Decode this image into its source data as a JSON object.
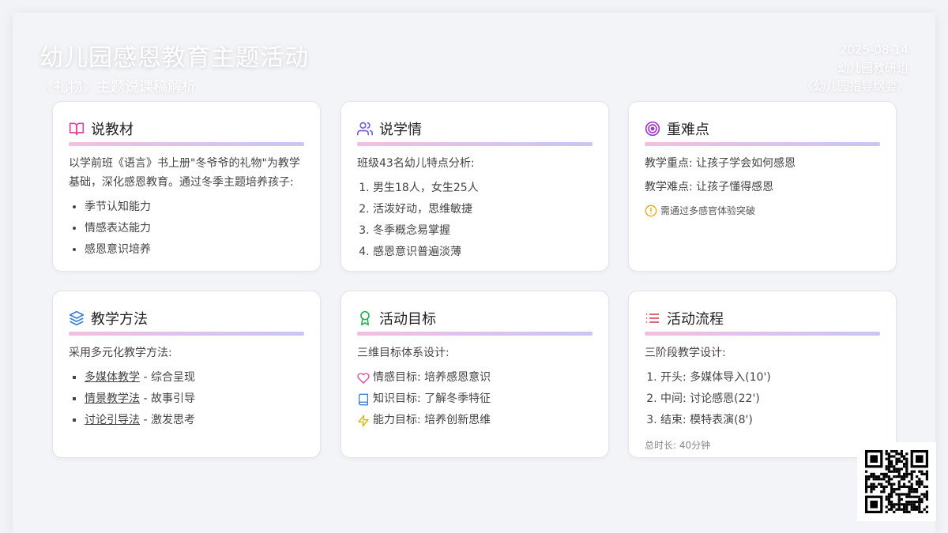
{
  "header": {
    "title": "幼儿园感恩教育主题活动",
    "subtitle": "《礼物》主题说课稿解析",
    "date": "2025-08-14",
    "org": "幼儿园教研组",
    "guide": "《幼儿园指导纲要》"
  },
  "cards": {
    "material": {
      "title": "说教材",
      "icon": "book-open-icon",
      "intro": "以学前班《语言》书上册\"冬爷爷的礼物\"为教学基础，深化感恩教育。通过冬季主题培养孩子:",
      "items": [
        "季节认知能力",
        "情感表达能力",
        "感恩意识培养"
      ]
    },
    "learners": {
      "title": "说学情",
      "icon": "users-icon",
      "intro": "班级43名幼儿特点分析:",
      "items": [
        "男生18人，女生25人",
        "活泼好动，思维敏捷",
        "冬季概念易掌握",
        "感恩意识普遍淡薄"
      ]
    },
    "focus": {
      "title": "重难点",
      "icon": "target-icon",
      "key_point": "教学重点: 让孩子学会如何感恩",
      "difficulty": "教学难点: 让孩子懂得感恩",
      "note": "需通过多感官体验突破",
      "note_icon": "alert-circle-icon"
    },
    "method": {
      "title": "教学方法",
      "icon": "layers-icon",
      "intro": "采用多元化教学方法:",
      "items": [
        {
          "name": "多媒体教学",
          "desc": " - 综合呈现"
        },
        {
          "name": "情景教学法",
          "desc": " - 故事引导"
        },
        {
          "name": "讨论引导法",
          "desc": " - 激发思考"
        }
      ]
    },
    "goals": {
      "title": "活动目标",
      "icon": "award-icon",
      "intro": "三维目标体系设计:",
      "items": [
        {
          "icon": "heart-icon",
          "text": "情感目标: 培养感恩意识"
        },
        {
          "icon": "book-icon",
          "text": "知识目标: 了解冬季特征"
        },
        {
          "icon": "zap-icon",
          "text": "能力目标: 培养创新思维"
        }
      ]
    },
    "flow": {
      "title": "活动流程",
      "icon": "list-icon",
      "intro": "三阶段教学设计:",
      "items": [
        "开头: 多媒体导入(10')",
        "中间: 讨论感恩(22')",
        "结束: 模特表演(8')"
      ],
      "total": "总时长: 40分钟"
    }
  },
  "colors": {
    "accent_pink": "#e0409a",
    "accent_purple": "#7b5fd6",
    "bar_start": "#f2bfe0",
    "bar_end": "#c9c6f4"
  }
}
